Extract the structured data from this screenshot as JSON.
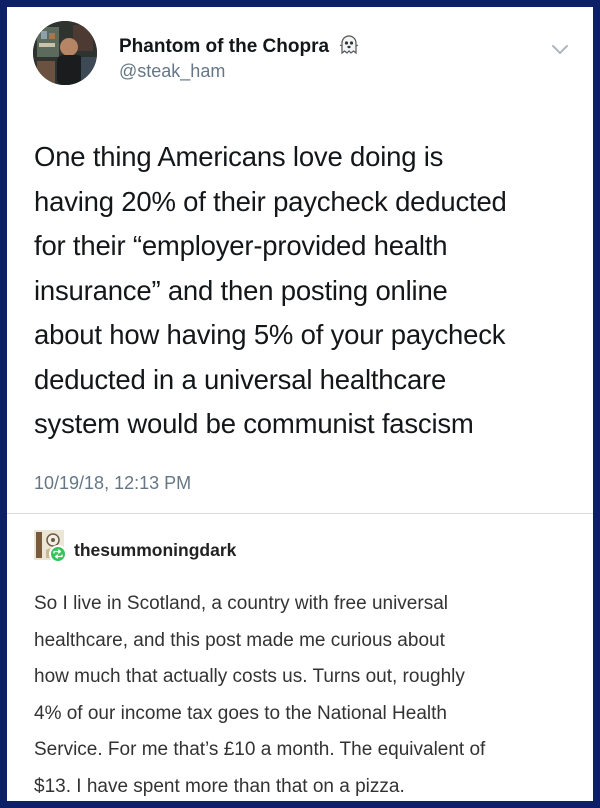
{
  "tweet": {
    "author_name": "Phantom of the Chopra",
    "author_emoji": "ghost-icon",
    "handle": "@steak_ham",
    "text_lines": [
      "One thing Americans love doing is",
      "having 20% of their paycheck deducted",
      "for their “employer-provided health",
      "insurance” and then posting online",
      "about how having 5% of your paycheck",
      "deducted in a universal healthcare",
      "system would be communist fascism"
    ],
    "timestamp": "10/19/18, 12:13 PM"
  },
  "reblog": {
    "username": "thesummoningdark",
    "badge_icon": "reblog-icon",
    "text_lines": [
      "So I live in Scotland, a country with free universal",
      "healthcare, and this post made me curious about",
      "how much that actually costs us. Turns out, roughly",
      "4% of our income tax goes to the National Health",
      "Service. For me that’s £10 a month. The equivalent of",
      "$13. I have spent more than that on a pizza."
    ]
  },
  "colors": {
    "frame_border": "#0d1f66",
    "name_text": "#14171a",
    "secondary_text": "#657786",
    "reblog_badge": "#38c25a"
  }
}
